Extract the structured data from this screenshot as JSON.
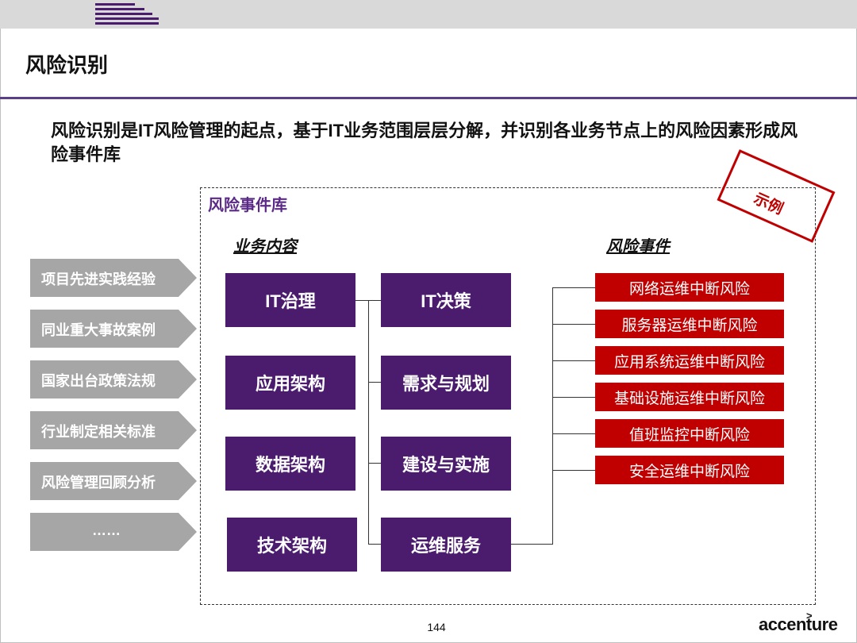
{
  "slide": {
    "title": "风险识别",
    "lead": "风险识别是IT风险管理的起点，基于IT业务范围层层分解，并识别各业务节点上的风险因素形成风险事件库",
    "library_title": "风险事件库",
    "stamp": "示例",
    "col_business": "业务内容",
    "col_risk": "风险事件",
    "sources": [
      "项目先进实践经验",
      "同业重大事故案例",
      "国家出台政策法规",
      "行业制定相关标准",
      "风险管理回顾分析",
      "……"
    ],
    "business_left": [
      "IT治理",
      "应用架构",
      "数据架构",
      "技术架构"
    ],
    "business_right": [
      "IT决策",
      "需求与规划",
      "建设与实施",
      "运维服务"
    ],
    "risks": [
      "网络运维中断风险",
      "服务器运维中断风险",
      "应用系统运维中断风险",
      "基础设施运维中断风险",
      "值班监控中断风险",
      "安全运维中断风险"
    ],
    "page_number": "144",
    "brand": "accenture",
    "brand_mark": ">"
  },
  "colors": {
    "accent_purple": "#4b1c6e",
    "title_purple": "#5b2a86",
    "risk_red": "#c00000",
    "source_gray": "#a6a6a6"
  }
}
